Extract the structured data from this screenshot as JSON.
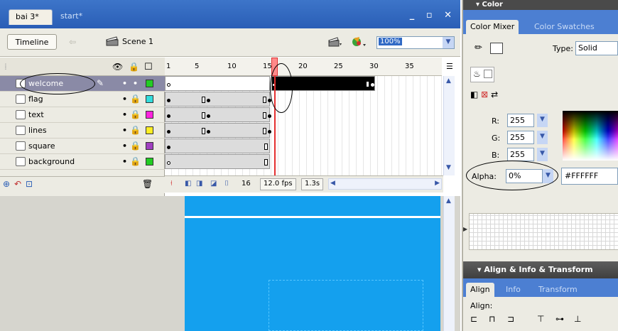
{
  "document": {
    "tabs": [
      {
        "label": "bai 3*",
        "active": true
      },
      {
        "label": "start*",
        "active": false
      }
    ],
    "window_controls": "_ ▫ ✕"
  },
  "edit_bar": {
    "timeline_button": "Timeline",
    "scene_label": "Scene 1",
    "zoom": "100%"
  },
  "layers": [
    {
      "name": "welcome",
      "color": "#22cc22",
      "selected": true
    },
    {
      "name": "flag",
      "color": "#33dddd",
      "selected": false
    },
    {
      "name": "text",
      "color": "#ff22dd",
      "selected": false
    },
    {
      "name": "lines",
      "color": "#ffee22",
      "selected": false
    },
    {
      "name": "square",
      "color": "#a040c0",
      "selected": false
    },
    {
      "name": "background",
      "color": "#22cc22",
      "selected": false
    }
  ],
  "timeline": {
    "ruler": [
      "1",
      "5",
      "10",
      "15",
      "20",
      "25",
      "30",
      "35"
    ],
    "current_frame": "16",
    "fps": "12.0 fps",
    "elapsed": "1.3s"
  },
  "color_panel": {
    "title": "Color",
    "tabs": [
      "Color Mixer",
      "Color Swatches"
    ],
    "type_label": "Type:",
    "type_value": "Solid",
    "r_label": "R:",
    "r_value": "255",
    "g_label": "G:",
    "g_value": "255",
    "b_label": "B:",
    "b_value": "255",
    "alpha_label": "Alpha:",
    "alpha_value": "0%",
    "hex_value": "#FFFFFF"
  },
  "align_panel": {
    "title": "Align & Info & Transform",
    "tabs": [
      "Align",
      "Info",
      "Transform"
    ],
    "align_label": "Align:"
  },
  "colors": {
    "stage_blue": "#14a0ee",
    "titlebar_blue": "#3d75c9",
    "playhead_red": "#e43030"
  }
}
